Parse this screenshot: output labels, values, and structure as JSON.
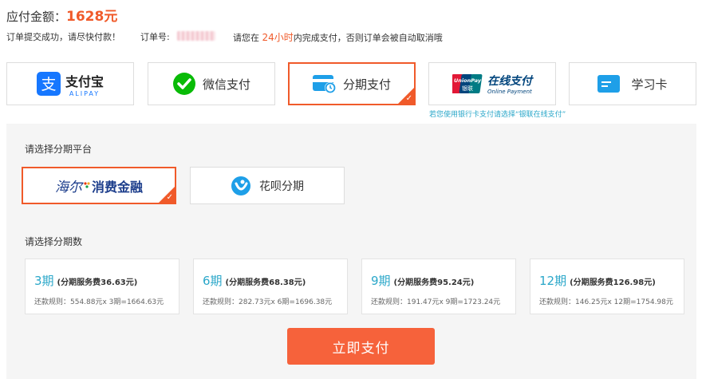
{
  "header": {
    "amount_label": "应付金额：",
    "amount_value": "1628元",
    "order_success": "订单提交成功，请尽快付款！",
    "order_no_label": "订单号:",
    "deadline_prefix": "请您在",
    "deadline_value": "24小时",
    "deadline_suffix": "内完成支付，否则订单会被自动取消哦"
  },
  "payment_methods": [
    {
      "name": "支付宝",
      "sub": "ALIPAY",
      "icon": "alipay-icon",
      "selected": false
    },
    {
      "name": "微信支付",
      "icon": "wechat-pay-icon",
      "selected": false
    },
    {
      "name": "分期支付",
      "icon": "installment-card-icon",
      "selected": true
    },
    {
      "name": "在线支付",
      "sub": "Online Payment",
      "brand": "UnionPay",
      "brand_cn": "银联",
      "icon": "unionpay-icon",
      "selected": false
    },
    {
      "name": "学习卡",
      "icon": "study-card-icon",
      "selected": false
    }
  ],
  "unionpay_hint": "若您使用银行卡支付请选择“银联在线支付”",
  "platform": {
    "title": "请选择分期平台",
    "options": [
      {
        "name": "海尔消费金融",
        "brand_script": "海尔",
        "brand_text": "消费金融",
        "icon": "haier-finance-logo",
        "selected": true
      },
      {
        "name": "花呗分期",
        "icon": "huabei-icon",
        "selected": false
      }
    ]
  },
  "terms": {
    "title": "请选择分期数",
    "options": [
      {
        "count": "3期",
        "fee": "(分期服务费36.63元)",
        "rule": "还款规则：554.88元x 3期=1664.63元"
      },
      {
        "count": "6期",
        "fee": "(分期服务费68.38元)",
        "rule": "还款规则：282.73元x 6期=1696.38元"
      },
      {
        "count": "9期",
        "fee": "(分期服务费95.24元)",
        "rule": "还款规则：191.47元x 9期=1723.24元"
      },
      {
        "count": "12期",
        "fee": "(分期服务费126.98元)",
        "rule": "还款规则：146.25元x 12期=1754.98元"
      }
    ]
  },
  "pay_button": "立即支付",
  "colors": {
    "accent": "#f05a2a",
    "teal": "#2aa7c9",
    "alipay": "#1677ff",
    "wechat": "#09bb07",
    "card": "#1e9fe8"
  }
}
